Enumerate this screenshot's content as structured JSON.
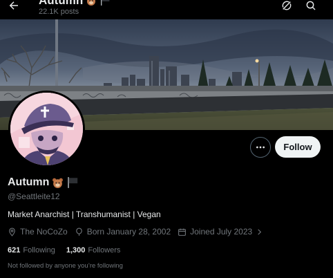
{
  "header": {
    "name": "Autumn",
    "posts": "22.1K posts",
    "icons": [
      "back-arrow-icon",
      "bear-emoji-icon",
      "black-flag-icon",
      "grok-icon",
      "search-icon"
    ]
  },
  "profile": {
    "display_name": "Autumn",
    "handle": "@Seattleite12",
    "bio": "Market Anarchist | Transhumanist | Vegan",
    "location": "The NoCoZo",
    "birthday": "Born January 28, 2002",
    "joined": "Joined July 2023",
    "following_count": "621",
    "following_label": "Following",
    "followers_count": "1,300",
    "followers_label": "Followers",
    "not_followed_text": "Not followed by anyone you’re following",
    "name_emojis": [
      "bear-emoji-icon",
      "black-flag-icon"
    ]
  },
  "actions": {
    "follow_label": "Follow",
    "more_icon": "more-horizontal-icon"
  },
  "colors": {
    "background": "#000000",
    "primary_text": "#e7e9ea",
    "secondary_text": "#71767b",
    "follow_button_bg": "#eff3f4",
    "border": "#536471",
    "avatar_bg": "#f3c7d3"
  }
}
